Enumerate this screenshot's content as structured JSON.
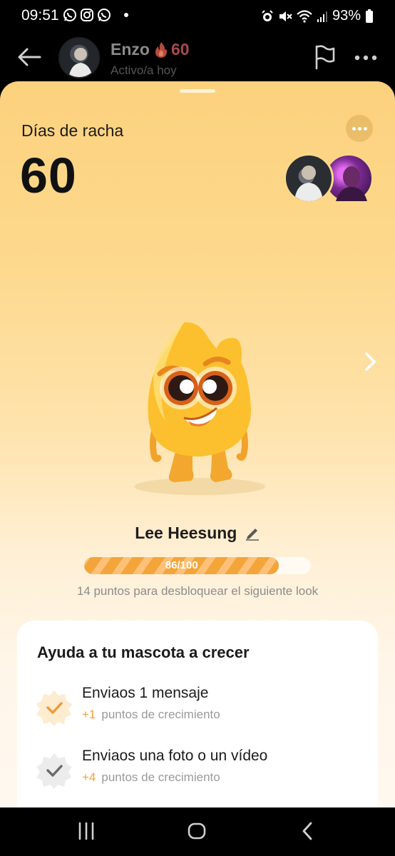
{
  "status_bar": {
    "time": "09:51",
    "battery": "93%",
    "notification_icons": [
      "whatsapp-icon",
      "instagram-icon",
      "whatsapp-icon"
    ],
    "system_icons": [
      "alarm-icon",
      "mute-icon",
      "wifi-icon",
      "signal-icon",
      "battery-icon"
    ]
  },
  "header": {
    "name": "Enzo",
    "streak": "60",
    "status": "Activo/a hoy"
  },
  "streak_card": {
    "label": "Días de racha",
    "value": "60"
  },
  "pet": {
    "name": "Lee Heesung",
    "progress_text": "86/100",
    "progress_fraction": 0.86,
    "hint": "14 puntos para desbloquear el siguiente look"
  },
  "tasks": {
    "title": "Ayuda a tu mascota a crecer",
    "items": [
      {
        "title": "Enviaos 1 mensaje",
        "points": "+1",
        "suffix": "puntos de crecimiento",
        "state": "done"
      },
      {
        "title": "Enviaos una foto o un vídeo",
        "points": "+4",
        "suffix": "puntos de crecimiento",
        "state": "pending"
      }
    ]
  },
  "colors": {
    "accent": "#f4a53a",
    "streak_red": "#a74a4f",
    "sheet_top": "#fcd17e"
  }
}
